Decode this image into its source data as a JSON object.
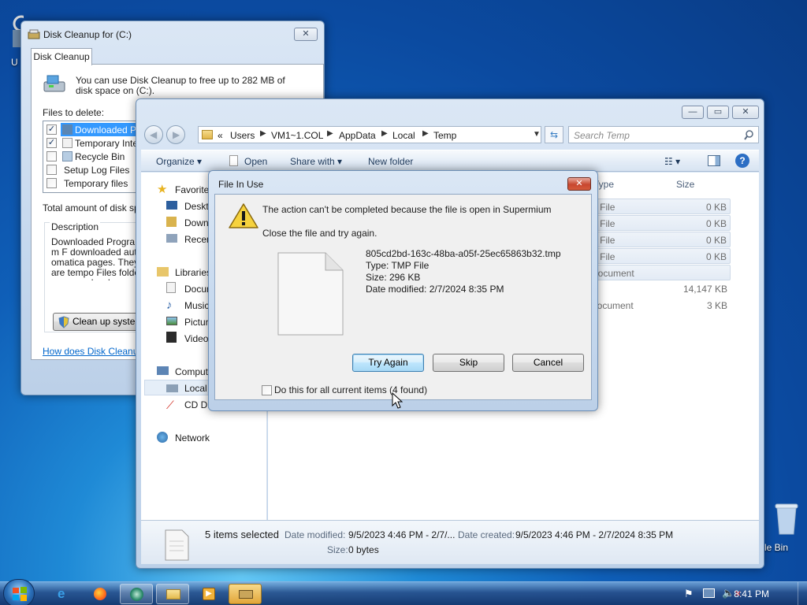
{
  "desktop": {
    "recycle_bin_label": "cle Bin",
    "left_icon_label": "U"
  },
  "disk_cleanup": {
    "title": "Disk Cleanup for  (C:)",
    "tab": "Disk Cleanup",
    "intro": "You can use Disk Cleanup to free up to 282 MB of disk space on  (C:).",
    "files_to_delete_label": "Files to delete:",
    "items": [
      {
        "label": "Downloaded Program Files",
        "checked": true,
        "selected": true
      },
      {
        "label": "Temporary Internet Files",
        "checked": true,
        "selected": false
      },
      {
        "label": "Recycle Bin",
        "checked": false,
        "selected": false
      },
      {
        "label": "Setup Log Files",
        "checked": false,
        "selected": false
      },
      {
        "label": "Temporary files",
        "checked": false,
        "selected": false
      }
    ],
    "total_label": "Total amount of disk spac",
    "description_label": "Description",
    "description_text": "Downloaded Program F downloaded automatica pages. They are tempo Files folder on your hard",
    "cleanup_system_button": "Clean up system f",
    "help_link": "How does Disk Cleanup w"
  },
  "explorer": {
    "breadcrumb": [
      "Users",
      "VM1~1.COL",
      "AppData",
      "Local",
      "Temp"
    ],
    "breadcrumb_prefix": "«",
    "search_placeholder": "Search Temp",
    "commands": {
      "organize": "Organize",
      "open": "Open",
      "share_with": "Share with",
      "new_folder": "New folder"
    },
    "nav": {
      "favorites": "Favorites",
      "desktop": "Desktop",
      "downloads": "Downloads",
      "recent": "Recent Places",
      "libraries": "Libraries",
      "documents": "Documents",
      "music": "Music",
      "pictures": "Pictures",
      "videos": "Videos",
      "computer": "Computer",
      "local_disk": "Local Disk (C:)",
      "cd_drive": "CD Drive",
      "network": "Network"
    },
    "columns": {
      "type": "Type",
      "size": "Size"
    },
    "files": [
      {
        "type": "P File",
        "size": "0 KB",
        "selected": true
      },
      {
        "type": "P File",
        "size": "0 KB",
        "selected": true
      },
      {
        "type": "P File",
        "size": "0 KB",
        "selected": true
      },
      {
        "type": "P File",
        "size": "0 KB",
        "selected": true
      },
      {
        "type": "Document",
        "size": "",
        "selected": true
      },
      {
        "type": "",
        "size": "14,147 KB",
        "selected": false
      },
      {
        "type": "Document",
        "size": "3 KB",
        "selected": false
      }
    ],
    "details": {
      "selection": "5 items selected",
      "date_modified_label": "Date modified:",
      "date_modified_value": "9/5/2023 4:46 PM - 2/7/...",
      "date_created_label": "Date created:",
      "date_created_value": "9/5/2023 4:46 PM - 2/7/2024 8:35 PM",
      "size_label": "Size:",
      "size_value": "0 bytes"
    }
  },
  "dialog": {
    "title": "File In Use",
    "message": "The action can't be completed because the file is open in Supermium",
    "instruction": "Close the file and try again.",
    "file_name": "805cd2bd-163c-48ba-a05f-25ec65863b32.tmp",
    "file_type": "Type: TMP File",
    "file_size": "Size: 296 KB",
    "file_date": "Date modified: 2/7/2024 8:35 PM",
    "try_again": "Try Again",
    "skip": "Skip",
    "cancel": "Cancel",
    "apply_all": "Do this for all current items (4 found)"
  },
  "taskbar": {
    "clock": "8:41 PM"
  }
}
